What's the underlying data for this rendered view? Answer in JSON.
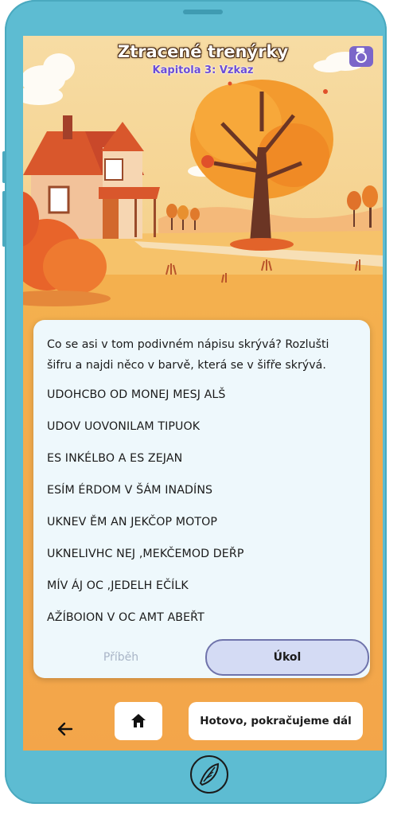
{
  "header": {
    "title": "Ztracené trenýrky",
    "subtitle": "Kapitola 3: Vzkaz",
    "camera_icon": "camera-icon"
  },
  "task": {
    "intro": "Co se asi v tom podivném nápisu skrývá? Rozlušti šifru a najdi něco v barvě, která se v šifře skrývá.",
    "cipher_lines": [
      "UDOHCBO OD MONEJ MESJ ALŠ",
      "UDOV UOVONILAM TIPUOK",
      "ES INKÉLBO A ES ZEJAN",
      "ESÍM ÉRDOM V ŠÁM INADÍNS",
      "UKNEV ĚM AN JEKČOP MOTOP",
      "UKNELIVHC NEJ ,MEKČEMOD DEŘP",
      "MÍV ÁJ OC ,JEDELH EČÍLK",
      "AŽÍBOJON V OC AMT ABEŘT"
    ]
  },
  "tabs": {
    "story": "Příběh",
    "task": "Úkol"
  },
  "nav": {
    "back_icon": "arrow-left-icon",
    "home_icon": "home-icon",
    "next_label": "Hotovo, pokračujeme dál"
  },
  "colors": {
    "phone_frame": "#5dbcd2",
    "screen_bg": "#f7b35a",
    "card_bg": "#eef8fc",
    "active_tab": "#d4dbf4",
    "accent_purple": "#6a4cd6"
  }
}
